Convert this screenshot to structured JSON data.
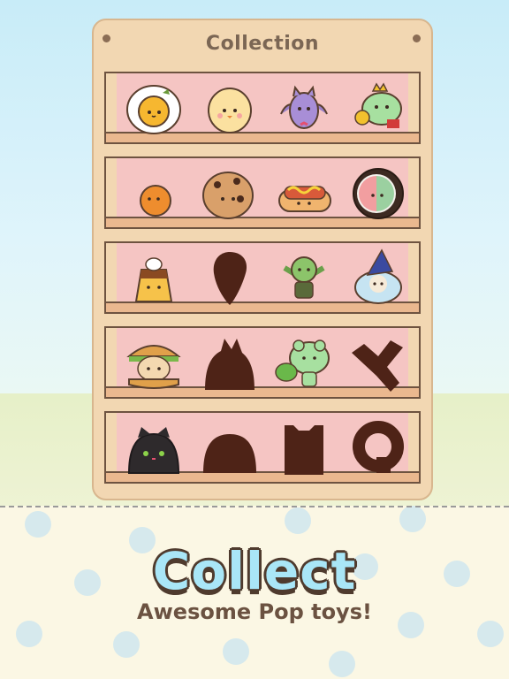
{
  "panel": {
    "title": "Collection"
  },
  "shelves": [
    {
      "items": [
        "fried-egg-toy",
        "chick-toy",
        "bat-toy",
        "frog-king-toy"
      ]
    },
    {
      "items": [
        "orange-toy",
        "cookie-toy",
        "hotdog-toy",
        "sushi-roll-toy"
      ]
    },
    {
      "items": [
        "pudding-toy",
        "locked-silhouette",
        "goblin-toy",
        "wizard-sheep-toy"
      ]
    },
    {
      "items": [
        "cat-burger-toy",
        "locked-silhouette",
        "frog-leaf-toy",
        "locked-silhouette"
      ]
    },
    {
      "items": [
        "black-cat-toy",
        "locked-silhouette",
        "locked-silhouette",
        "locked-silhouette"
      ]
    }
  ],
  "banner": {
    "headline": "Collect",
    "tagline": "Awesome Pop toys!"
  },
  "colors": {
    "shelf_back": "#f5c5c3",
    "wood": "#f2d7b2",
    "outline": "#6e5340",
    "silhouette": "#4e2317",
    "headline": "#a9e6f7"
  }
}
